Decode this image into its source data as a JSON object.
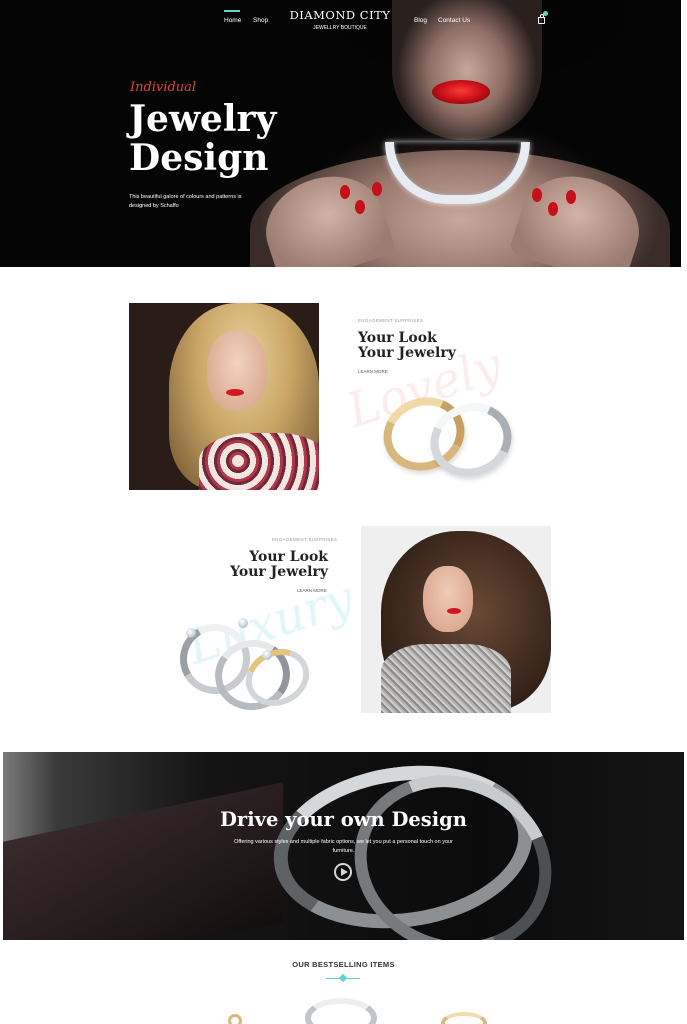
{
  "nav": {
    "home": "Home",
    "shop": "Shop",
    "blog": "Blog",
    "contact": "Contact Us"
  },
  "brand": {
    "title": "DIAMOND CITY",
    "subtitle": "JEWELLRY BOUTIQUE"
  },
  "hero": {
    "eyebrow": "Individual",
    "title_line1": "Jewelry",
    "title_line2": "Design",
    "description": "This beautiful galore of colours and patterns is designed by Schaffo"
  },
  "feature_1": {
    "eyebrow": "ENGAGEMENT SURPRISES",
    "title_line1": "Your Look",
    "title_line2": "Your Jewelry",
    "link": "LEARN MORE",
    "script_word": "Lovely"
  },
  "feature_2": {
    "eyebrow": "ENGAGEMENT SURPRISES",
    "title_line1": "Your Look",
    "title_line2": "Your Jewelry",
    "link": "LEARN MORE",
    "script_word": "Luxury"
  },
  "banner": {
    "title": "Drive your own Design",
    "text": "Offering various styles and multiple fabric options, we let you put a personal touch on your furniture."
  },
  "bestsellers": {
    "title": "OUR BESTSELLING ITEMS"
  },
  "colors": {
    "accent": "#5fd6c6",
    "hero_eyebrow": "#e0463c"
  },
  "icons": {
    "cart": "shopping-bag-icon",
    "play": "play-icon"
  }
}
